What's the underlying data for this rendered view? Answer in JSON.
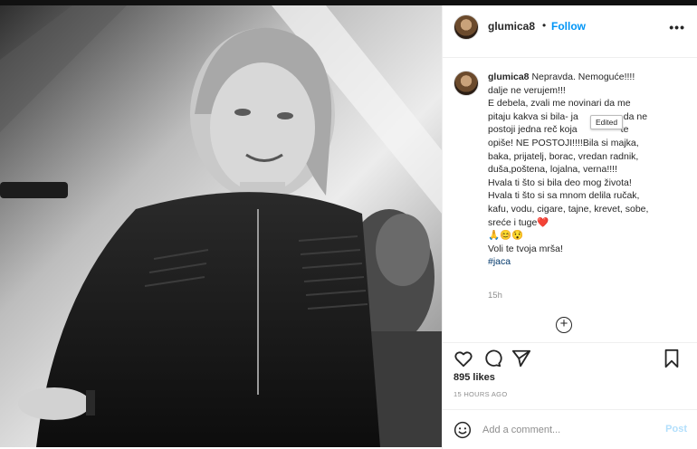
{
  "post": {
    "username": "glumica8",
    "dot": "•",
    "follow_label": "Follow",
    "more_label": "•••"
  },
  "caption": {
    "username": "glumica8",
    "lines": [
      " Nepravda. Nemoguće!!!!",
      "dalje ne verujem!!!",
      "E debela, zvali me novinari da me",
      "pitaju kakva si bila- ja",
      "postoji jedna reč koja",
      "opiše! NE POSTOJI!!!!Bila si majka,",
      "baka, prijatelj, borac, vredan radnik,",
      "duša,poštena, lojalna, verna!!!!",
      "Hvala ti što si bila deo mog života!",
      "Hvala ti što si sa mnom delila ručak,",
      "kafu, vodu, cigare, tajne, krevet, sobe,",
      "sreće i tuge❤️",
      "🙏😊😯",
      "Voli te tvoja mrša!"
    ],
    "line4_tail": "da ne",
    "line5_tail": "te",
    "hashtag": "#jaca",
    "edited_tooltip": "Edited",
    "time_short": "15h"
  },
  "engagement": {
    "likes": "895 likes",
    "time_ago": "15 HOURS AGO"
  },
  "comment": {
    "placeholder": "Add a comment...",
    "post_label": "Post"
  },
  "icons": {
    "like": "heart-icon",
    "comment": "comment-bubble-icon",
    "share": "paper-plane-icon",
    "save": "bookmark-icon",
    "emoji": "smiley-icon",
    "add": "plus-circle-icon"
  },
  "colors": {
    "accent": "#0095f6",
    "post_disabled": "#b2dffc",
    "hashtag": "#00376b",
    "muted": "#8e8e8e"
  }
}
